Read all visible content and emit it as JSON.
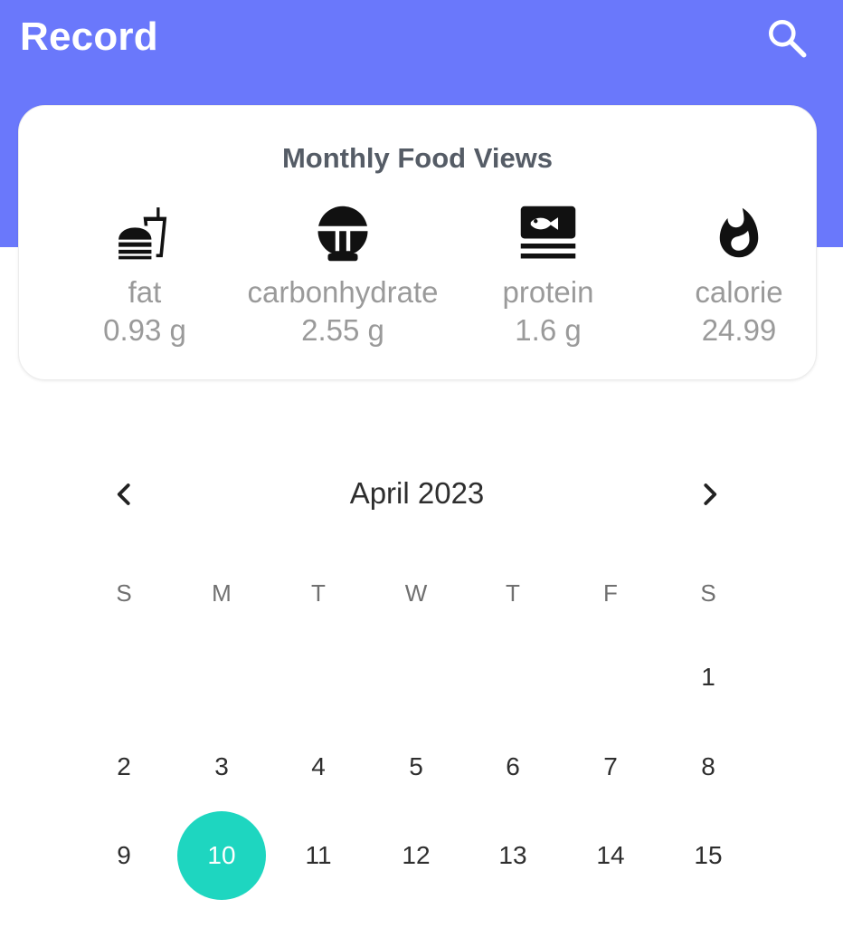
{
  "appbar": {
    "title": "Record",
    "search_icon": "search-icon",
    "color": "#6a78fb"
  },
  "summary": {
    "title": "Monthly Food Views",
    "nutrients": [
      {
        "icon": "fastfood-icon",
        "label": "fat",
        "value": "0.93 g"
      },
      {
        "icon": "rice-bowl-icon",
        "label": "carbonhydrate",
        "value": "2.55 g"
      },
      {
        "icon": "set-meal-icon",
        "label": "protein",
        "value": "1.6 g"
      },
      {
        "icon": "fire-icon",
        "label": "calorie",
        "value": "24.99"
      }
    ]
  },
  "calendar": {
    "month_label": "April 2023",
    "prev_icon": "chevron-left-icon",
    "next_icon": "chevron-right-icon",
    "weekdays": [
      "S",
      "M",
      "T",
      "W",
      "T",
      "F",
      "S"
    ],
    "weeks": [
      [
        "",
        "",
        "",
        "",
        "",
        "",
        "1"
      ],
      [
        "2",
        "3",
        "4",
        "5",
        "6",
        "7",
        "8"
      ],
      [
        "9",
        "10",
        "11",
        "12",
        "13",
        "14",
        "15"
      ]
    ],
    "selected_day": "10",
    "selected_color": "#1ed6c0"
  }
}
